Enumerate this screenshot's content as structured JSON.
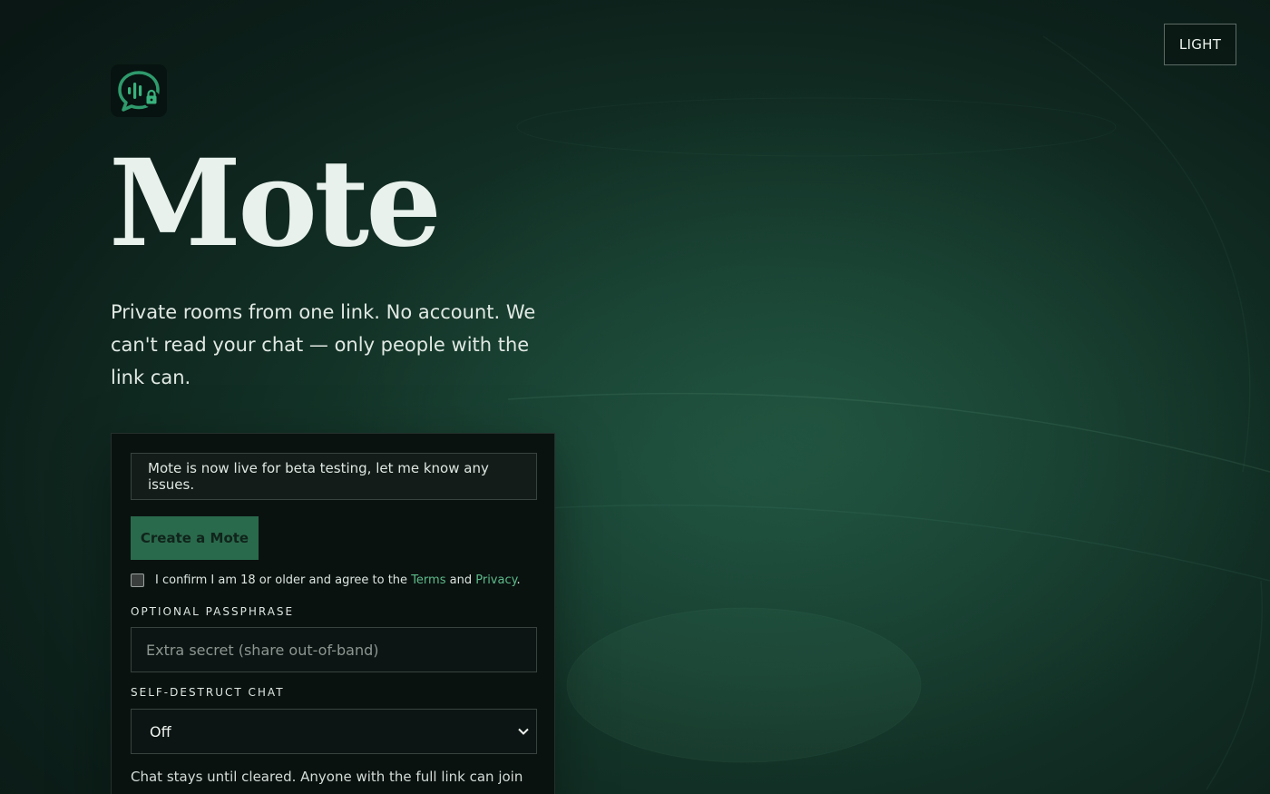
{
  "app": {
    "title": "Mote",
    "tagline": "Private rooms from one link. No account. We can't read your chat — only people with the link can."
  },
  "header": {
    "theme_toggle_label": "LIGHT"
  },
  "logo": {
    "icon": "chat-bubble-lock-icon"
  },
  "card": {
    "notice": "Mote is now live for beta testing, let me know any issues.",
    "create_button": "Create a Mote",
    "consent": {
      "checked": false,
      "prefix": "I confirm I am 18 or older and agree to the",
      "terms": "Terms",
      "and": "and",
      "privacy": "Privacy",
      "suffix": "."
    },
    "passphrase": {
      "label": "OPTIONAL PASSPHRASE",
      "placeholder": "Extra secret (share out-of-band)",
      "value": ""
    },
    "self_destruct": {
      "label": "SELF-DESTRUCT CHAT",
      "selected": "Off"
    },
    "help_text": "Chat stays until cleared. Anyone with the full link can join"
  },
  "colors": {
    "accent": "#5dbb8a",
    "button": "#2a6a4c",
    "background": "#143529"
  }
}
